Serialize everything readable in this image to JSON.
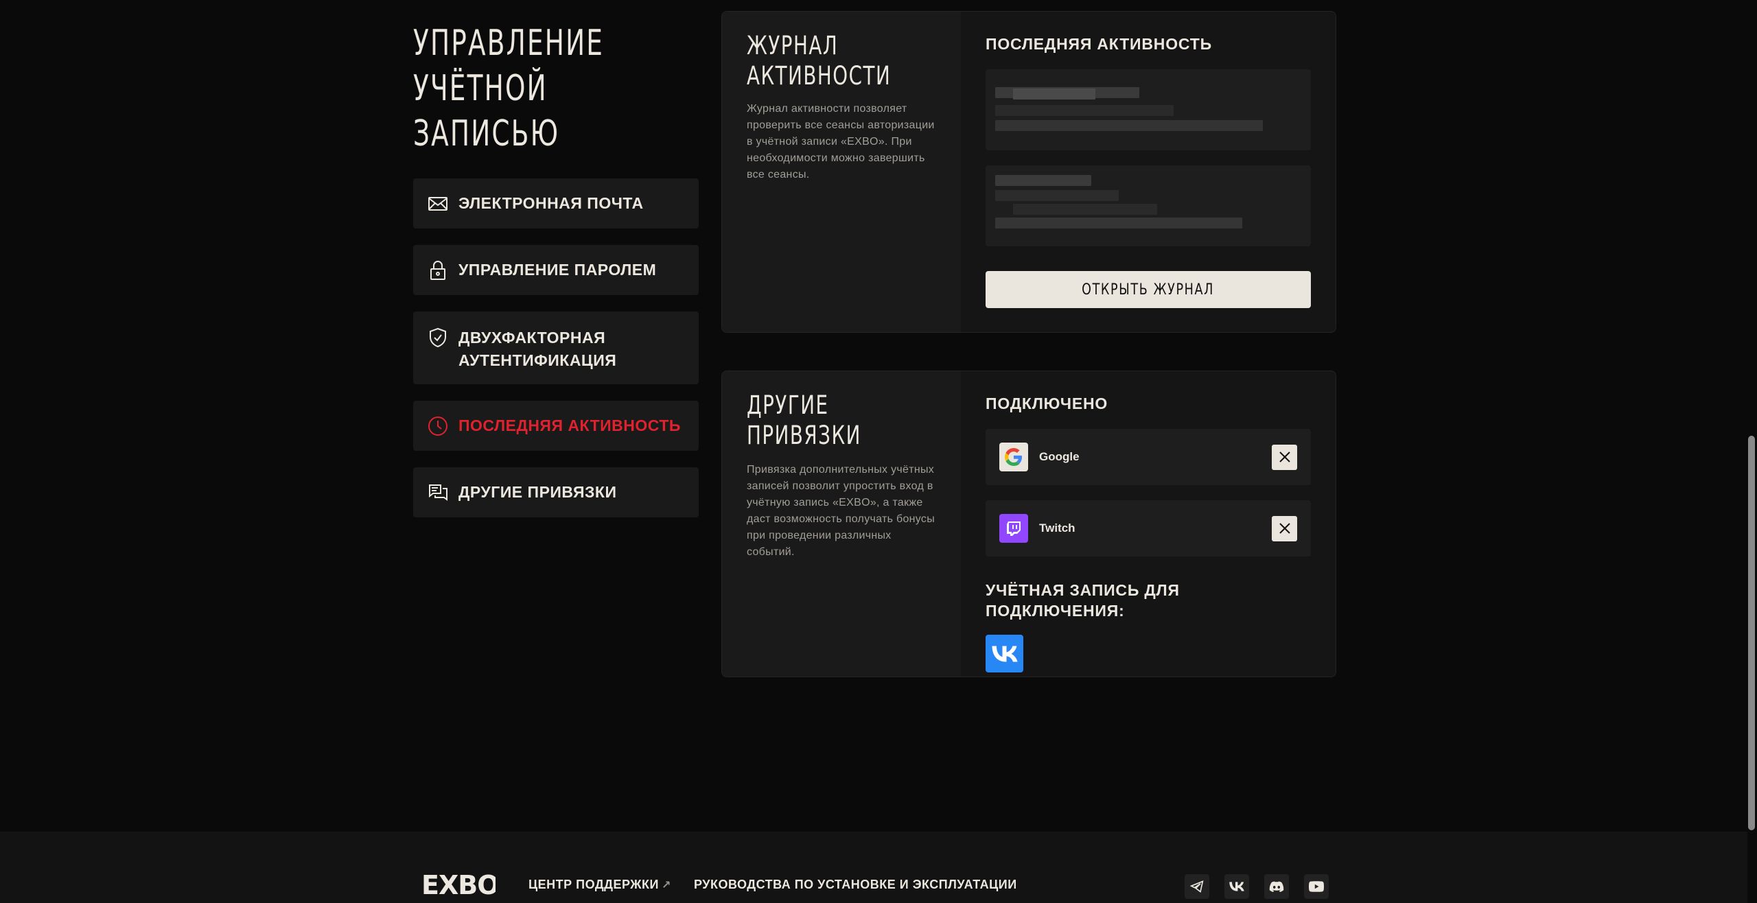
{
  "sidebar": {
    "title_line1": "Управление",
    "title_line2": "учётной записью",
    "items": [
      {
        "label": "Электронная почта",
        "icon": "mail-icon"
      },
      {
        "label": "Управление паролем",
        "icon": "lock-icon"
      },
      {
        "label": "Двухфакторная аутентификация",
        "icon": "shield-check-icon"
      },
      {
        "label": "Последняя активность",
        "icon": "clock-icon",
        "active": true
      },
      {
        "label": "Другие привязки",
        "icon": "chat-icon"
      }
    ]
  },
  "activity_card": {
    "title_line1": "Журнал",
    "title_line2": "активности",
    "description": "Журнал активности позволяет проверить все сеансы авторизации в учётной записи «EXBO». При необходимости можно завершить все сеансы.",
    "section_heading": "Последняя активность",
    "open_button": "Открыть журнал"
  },
  "links_card": {
    "title": "Другие привязки",
    "description": "Привязка дополнительных учётных записей позволит упростить вход в учётную запись «EXBO», а также даст возможность получать бонусы при проведении различных событий.",
    "connected_heading": "Подключено",
    "connected": [
      {
        "name": "Google",
        "icon": "google-icon"
      },
      {
        "name": "Twitch",
        "icon": "twitch-icon"
      }
    ],
    "connect_heading": "Учётная запись для подключения:",
    "available": [
      {
        "icon": "vk-icon"
      }
    ]
  },
  "footer": {
    "logo": "EXBO",
    "support_link": "Центр поддержки",
    "support_arrow": "↗",
    "guides_link": "Руководства по установке и эксплуатации",
    "socials": [
      "telegram-icon",
      "vk-icon",
      "discord-icon",
      "youtube-icon"
    ]
  },
  "colors": {
    "background": "#0a0a0a",
    "card": "#151515",
    "accent_red": "#e0222e",
    "button_light": "#ebe6dd",
    "twitch": "#9146ff",
    "vk": "#2787f5"
  }
}
